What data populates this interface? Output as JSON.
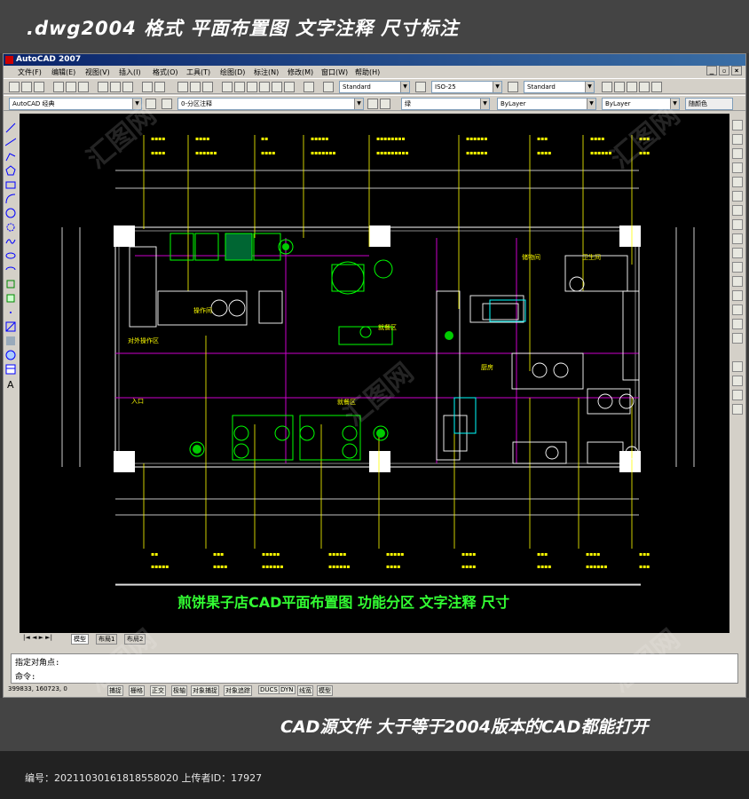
{
  "banner_top": {
    "text": ".dwg2004 格式  平面布置图 文字注释 尺寸标注"
  },
  "app": {
    "title": "AutoCAD 2007"
  },
  "menu": [
    "文件(F)",
    "编辑(E)",
    "视图(V)",
    "插入(I)",
    "格式(O)",
    "工具(T)",
    "绘图(D)",
    "标注(N)",
    "修改(M)",
    "窗口(W)",
    "帮助(H)"
  ],
  "toolbar": {
    "text_style": "Standard",
    "dim_style": "ISO-25",
    "table_style": "Standard",
    "workspace": "AutoCAD 经典",
    "layer": "0-分区注释",
    "color": "绿",
    "linetype": "ByLayer",
    "lineweight": "ByLayer",
    "plotstyle": "随颜色"
  },
  "drawing": {
    "title": "煎饼果子店CAD平面布置图   功能分区   文字注释   尺寸",
    "labels": [
      "对外操作区",
      "操作间",
      "就餐区",
      "入口",
      "储物间",
      "卫生间",
      "厨房",
      "就餐区"
    ]
  },
  "tabs": [
    "模型",
    "布局1",
    "布局2"
  ],
  "command": {
    "line1": "指定对角点:",
    "line2": "命令:"
  },
  "status": {
    "coords": "399833, 160723, 0",
    "buttons": [
      "捕捉",
      "栅格",
      "正交",
      "极轴",
      "对象捕捉",
      "对象追踪",
      "DUCS",
      "DYN",
      "线宽",
      "模型"
    ]
  },
  "banner_bottom": {
    "text": "CAD源文件  大于等于2004版本的CAD都能打开"
  },
  "footer": {
    "text": "编号：20211030161818558020 上传者ID：17927"
  },
  "watermark": "汇图网"
}
